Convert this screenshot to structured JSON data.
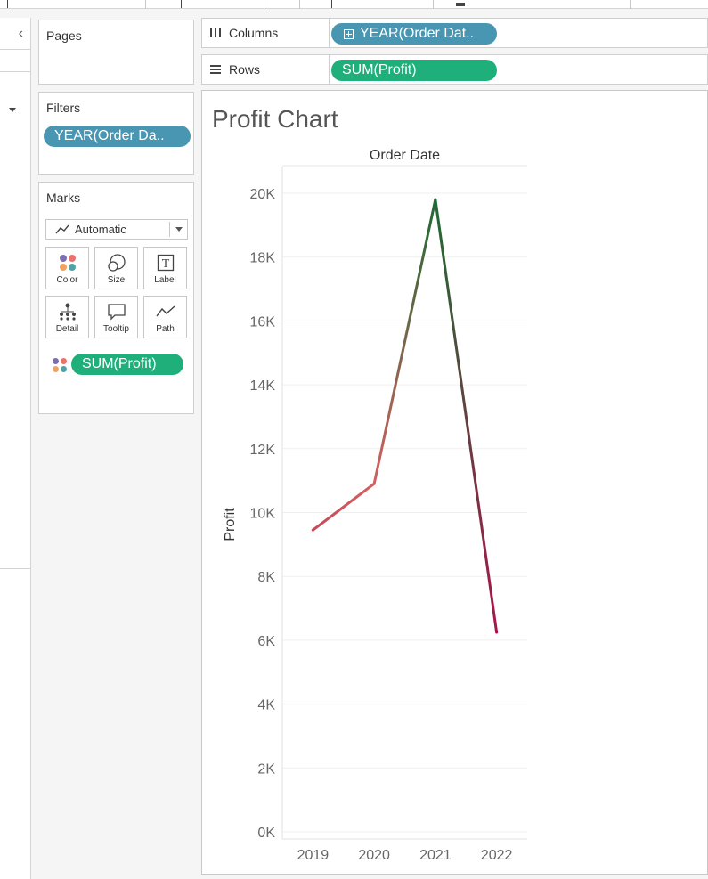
{
  "shelves": {
    "columns_label": "Columns",
    "columns_pill": "YEAR(Order Dat..",
    "rows_label": "Rows",
    "rows_pill": "SUM(Profit)"
  },
  "cards": {
    "pages_title": "Pages",
    "filters_title": "Filters",
    "filter_pill": "YEAR(Order Da..",
    "marks_title": "Marks",
    "mark_type": "Automatic",
    "mark_buttons": [
      "Color",
      "Size",
      "Label",
      "Detail",
      "Tooltip",
      "Path"
    ],
    "marks_pill": "SUM(Profit)"
  },
  "colors": {
    "dimension_pill": "#4996b2",
    "measure_pill": "#1faf7b",
    "gradient_low": "#a8164c",
    "gradient_mid": "#e8826a",
    "gradient_high": "#1e6b33"
  },
  "chart_data": {
    "type": "line",
    "title": "Profit Chart",
    "header": "Order Date",
    "ylabel": "Profit",
    "categories": [
      "2019",
      "2020",
      "2021",
      "2022"
    ],
    "values": [
      9450,
      10900,
      19800,
      6250
    ],
    "yticks": [
      "0K",
      "2K",
      "4K",
      "6K",
      "8K",
      "10K",
      "12K",
      "14K",
      "16K",
      "18K",
      "20K"
    ],
    "ylim": [
      0,
      20000
    ],
    "grid": true
  }
}
